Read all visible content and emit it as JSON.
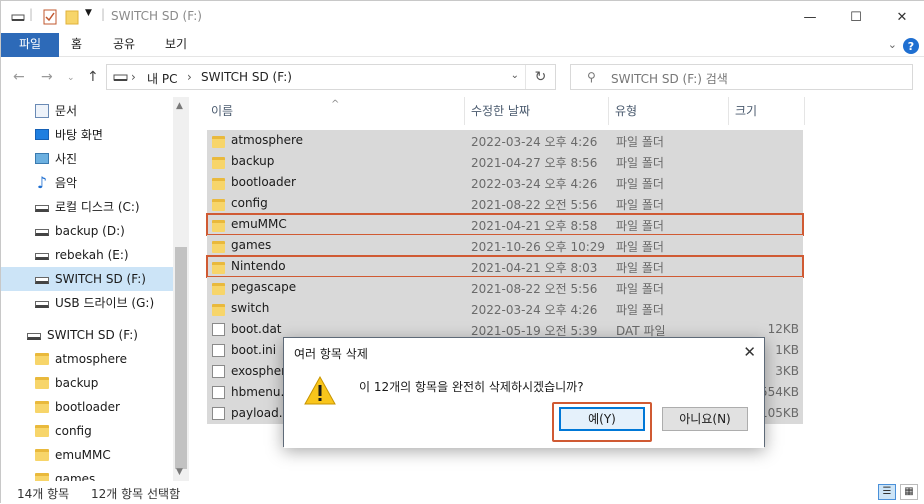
{
  "window": {
    "title": "SWITCH SD (F:)",
    "minimize": "—",
    "maximize": "☐",
    "close": "✕"
  },
  "ribbon": {
    "tabs": [
      "파일",
      "홈",
      "공유",
      "보기"
    ],
    "help": "?"
  },
  "address": {
    "path": [
      "내 PC",
      "SWITCH SD (F:)"
    ],
    "separator": "›",
    "search_placeholder": "SWITCH SD (F:) 검색"
  },
  "nav": {
    "items": [
      {
        "label": "문서",
        "icon": "document-icon"
      },
      {
        "label": "바탕 화면",
        "icon": "desktop-icon"
      },
      {
        "label": "사진",
        "icon": "pictures-icon"
      },
      {
        "label": "음악",
        "icon": "music-icon"
      },
      {
        "label": "로컬 디스크 (C:)",
        "icon": "drive-icon"
      },
      {
        "label": "backup (D:)",
        "icon": "drive-icon"
      },
      {
        "label": "rebekah (E:)",
        "icon": "drive-icon"
      },
      {
        "label": "SWITCH SD (F:)",
        "icon": "drive-icon",
        "selected": true
      },
      {
        "label": "USB 드라이브 (G:)",
        "icon": "drive-icon"
      }
    ],
    "tree_root": "SWITCH SD (F:)",
    "tree_children": [
      "atmosphere",
      "backup",
      "bootloader",
      "config",
      "emuMMC",
      "games"
    ]
  },
  "columns": {
    "name": "이름",
    "date": "수정한 날짜",
    "type": "유형",
    "size": "크기"
  },
  "files": [
    {
      "name": "atmosphere",
      "date": "2022-03-24 오후 4:26",
      "type": "파일 폴더",
      "size": "",
      "kind": "folder"
    },
    {
      "name": "backup",
      "date": "2021-04-27 오후 8:56",
      "type": "파일 폴더",
      "size": "",
      "kind": "folder"
    },
    {
      "name": "bootloader",
      "date": "2022-03-24 오후 4:26",
      "type": "파일 폴더",
      "size": "",
      "kind": "folder"
    },
    {
      "name": "config",
      "date": "2021-08-22 오전 5:56",
      "type": "파일 폴더",
      "size": "",
      "kind": "folder"
    },
    {
      "name": "emuMMC",
      "date": "2021-04-21 오후 8:58",
      "type": "파일 폴더",
      "size": "",
      "kind": "folder",
      "highlight": true
    },
    {
      "name": "games",
      "date": "2021-10-26 오후 10:29",
      "type": "파일 폴더",
      "size": "",
      "kind": "folder"
    },
    {
      "name": "Nintendo",
      "date": "2021-04-21 오후 8:03",
      "type": "파일 폴더",
      "size": "",
      "kind": "folder",
      "highlight": true
    },
    {
      "name": "pegascape",
      "date": "2021-08-22 오전 5:56",
      "type": "파일 폴더",
      "size": "",
      "kind": "folder"
    },
    {
      "name": "switch",
      "date": "2022-03-24 오후 4:26",
      "type": "파일 폴더",
      "size": "",
      "kind": "folder"
    },
    {
      "name": "boot.dat",
      "date": "2021-05-19 오전 5:39",
      "type": "DAT 파일",
      "size": "12KB",
      "kind": "file"
    },
    {
      "name": "boot.ini",
      "date": "",
      "type": "",
      "size": "1KB",
      "kind": "settings"
    },
    {
      "name": "exosphere",
      "date": "",
      "type": "",
      "size": "3KB",
      "kind": "settings"
    },
    {
      "name": "hbmenu.n",
      "date": "",
      "type": "",
      "size": "554KB",
      "kind": "file"
    },
    {
      "name": "payload.b",
      "date": "",
      "type": "",
      "size": "105KB",
      "kind": "file"
    }
  ],
  "status": {
    "count": "14개 항목",
    "selected": "12개 항목 선택함"
  },
  "dialog": {
    "title": "여러 항목 삭제",
    "message": "이 12개의 항목을 완전히 삭제하시겠습니까?",
    "yes": "예(Y)",
    "no": "아니요(N)",
    "close": "✕"
  },
  "colors": {
    "accent": "#2d6ab8",
    "selection": "#d9d9d9",
    "highlight_outline": "#d05a33"
  }
}
